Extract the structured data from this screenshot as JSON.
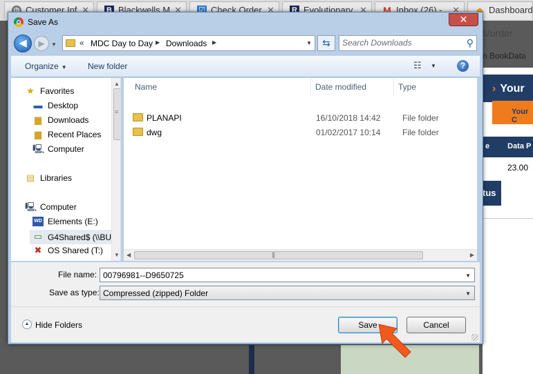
{
  "browser": {
    "tabs": [
      {
        "label": "Customer Inf",
        "icon": "globe-icon",
        "color": "#777777"
      },
      {
        "label": "Blackwells M",
        "icon": "b-logo-icon",
        "color": "#1b2a5b"
      },
      {
        "label": "Check Order",
        "icon": "check-order-icon",
        "color": "#2e7bcf"
      },
      {
        "label": "Evolutionary",
        "icon": "r-logo-icon",
        "color": "#1b2a5b"
      },
      {
        "label": "Inbox (26) - ",
        "icon": "gmail-icon",
        "color": "#d93025"
      },
      {
        "label": "Dashboard",
        "icon": "dashboard-icon",
        "color": "#e8a418"
      }
    ],
    "url_fragment": "ps/order",
    "bookmark_fragment": "n BookData",
    "page": {
      "heading": "Your",
      "heading_marker": "›",
      "orange_tab": "Your C",
      "header_cell_left": "e",
      "header_cell_right": "Data P",
      "value": "23.00",
      "button_fragment": "tus"
    }
  },
  "dialog": {
    "title": "Save As",
    "close_label": "✕",
    "address": {
      "overflow": "«",
      "segments": [
        "MDC Day to Day",
        "Downloads"
      ]
    },
    "search_placeholder": "Search Downloads",
    "toolbar": {
      "organize_label": "Organize",
      "new_folder_label": "New folder"
    },
    "nav_pane": [
      {
        "label": "Favorites",
        "icon": "star-icon",
        "level": 0
      },
      {
        "label": "Desktop",
        "icon": "desktop-icon",
        "level": 1
      },
      {
        "label": "Downloads",
        "icon": "downloads-folder-icon",
        "level": 1
      },
      {
        "label": "Recent Places",
        "icon": "recent-places-icon",
        "level": 1
      },
      {
        "label": "Computer",
        "icon": "computer-icon",
        "level": 1
      },
      {
        "label": "Libraries",
        "icon": "libraries-icon",
        "level": 0
      },
      {
        "label": "Computer",
        "icon": "computer-icon",
        "level": 0
      },
      {
        "label": "Elements (E:)",
        "icon": "wd-drive-icon",
        "level": 1
      },
      {
        "label": "G4Shared$ (\\\\BU",
        "icon": "network-drive-icon",
        "level": 1,
        "selected": true
      },
      {
        "label": "OS Shared (T:)",
        "icon": "disconnected-drive-icon",
        "level": 1
      }
    ],
    "columns": {
      "name": "Name",
      "date": "Date modified",
      "type": "Type"
    },
    "files": [
      {
        "name": "PLANAPI",
        "date": "16/10/2018 14:42",
        "type": "File folder"
      },
      {
        "name": "dwg",
        "date": "01/02/2017 10:14",
        "type": "File folder"
      }
    ],
    "form": {
      "file_name_label": "File name:",
      "file_name_value": "00796981--D9650725",
      "save_type_label": "Save as type:",
      "save_type_value": "Compressed (zipped) Folder"
    },
    "hide_folders_label": "Hide Folders",
    "save_label": "Save",
    "cancel_label": "Cancel"
  },
  "colors": {
    "dialog_frame": "#b9cfe8",
    "brand_navy": "#213d66",
    "brand_orange": "#f07b1d",
    "annotation_arrow": "#f25a1d"
  }
}
